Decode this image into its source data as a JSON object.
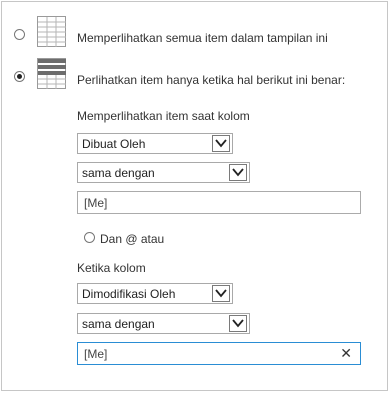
{
  "filter": {
    "option_all": {
      "label": "Memperlihatkan semua item dalam tampilan ini",
      "selected": false
    },
    "option_conditional": {
      "label": "Perlihatkan item hanya ketika hal berikut ini benar:",
      "selected": true
    }
  },
  "condition1": {
    "heading": "Memperlihatkan item saat kolom",
    "column_value": "Dibuat Oleh",
    "operator_value": "sama dengan",
    "value_text": "[Me]"
  },
  "logic": {
    "label": "Dan @ atau"
  },
  "condition2": {
    "heading": "Ketika kolom",
    "column_value": "Dimodifikasi Oleh",
    "operator_value": "sama dengan",
    "value_text": "[Me]",
    "clear_glyph": "✕"
  },
  "icons": {
    "all_items": "list-view-icon",
    "filtered_items": "filtered-list-icon",
    "dropdown": "chevron-down-icon"
  },
  "colors": {
    "focus_border": "#2a8dd4",
    "border": "#c6c6c6"
  }
}
